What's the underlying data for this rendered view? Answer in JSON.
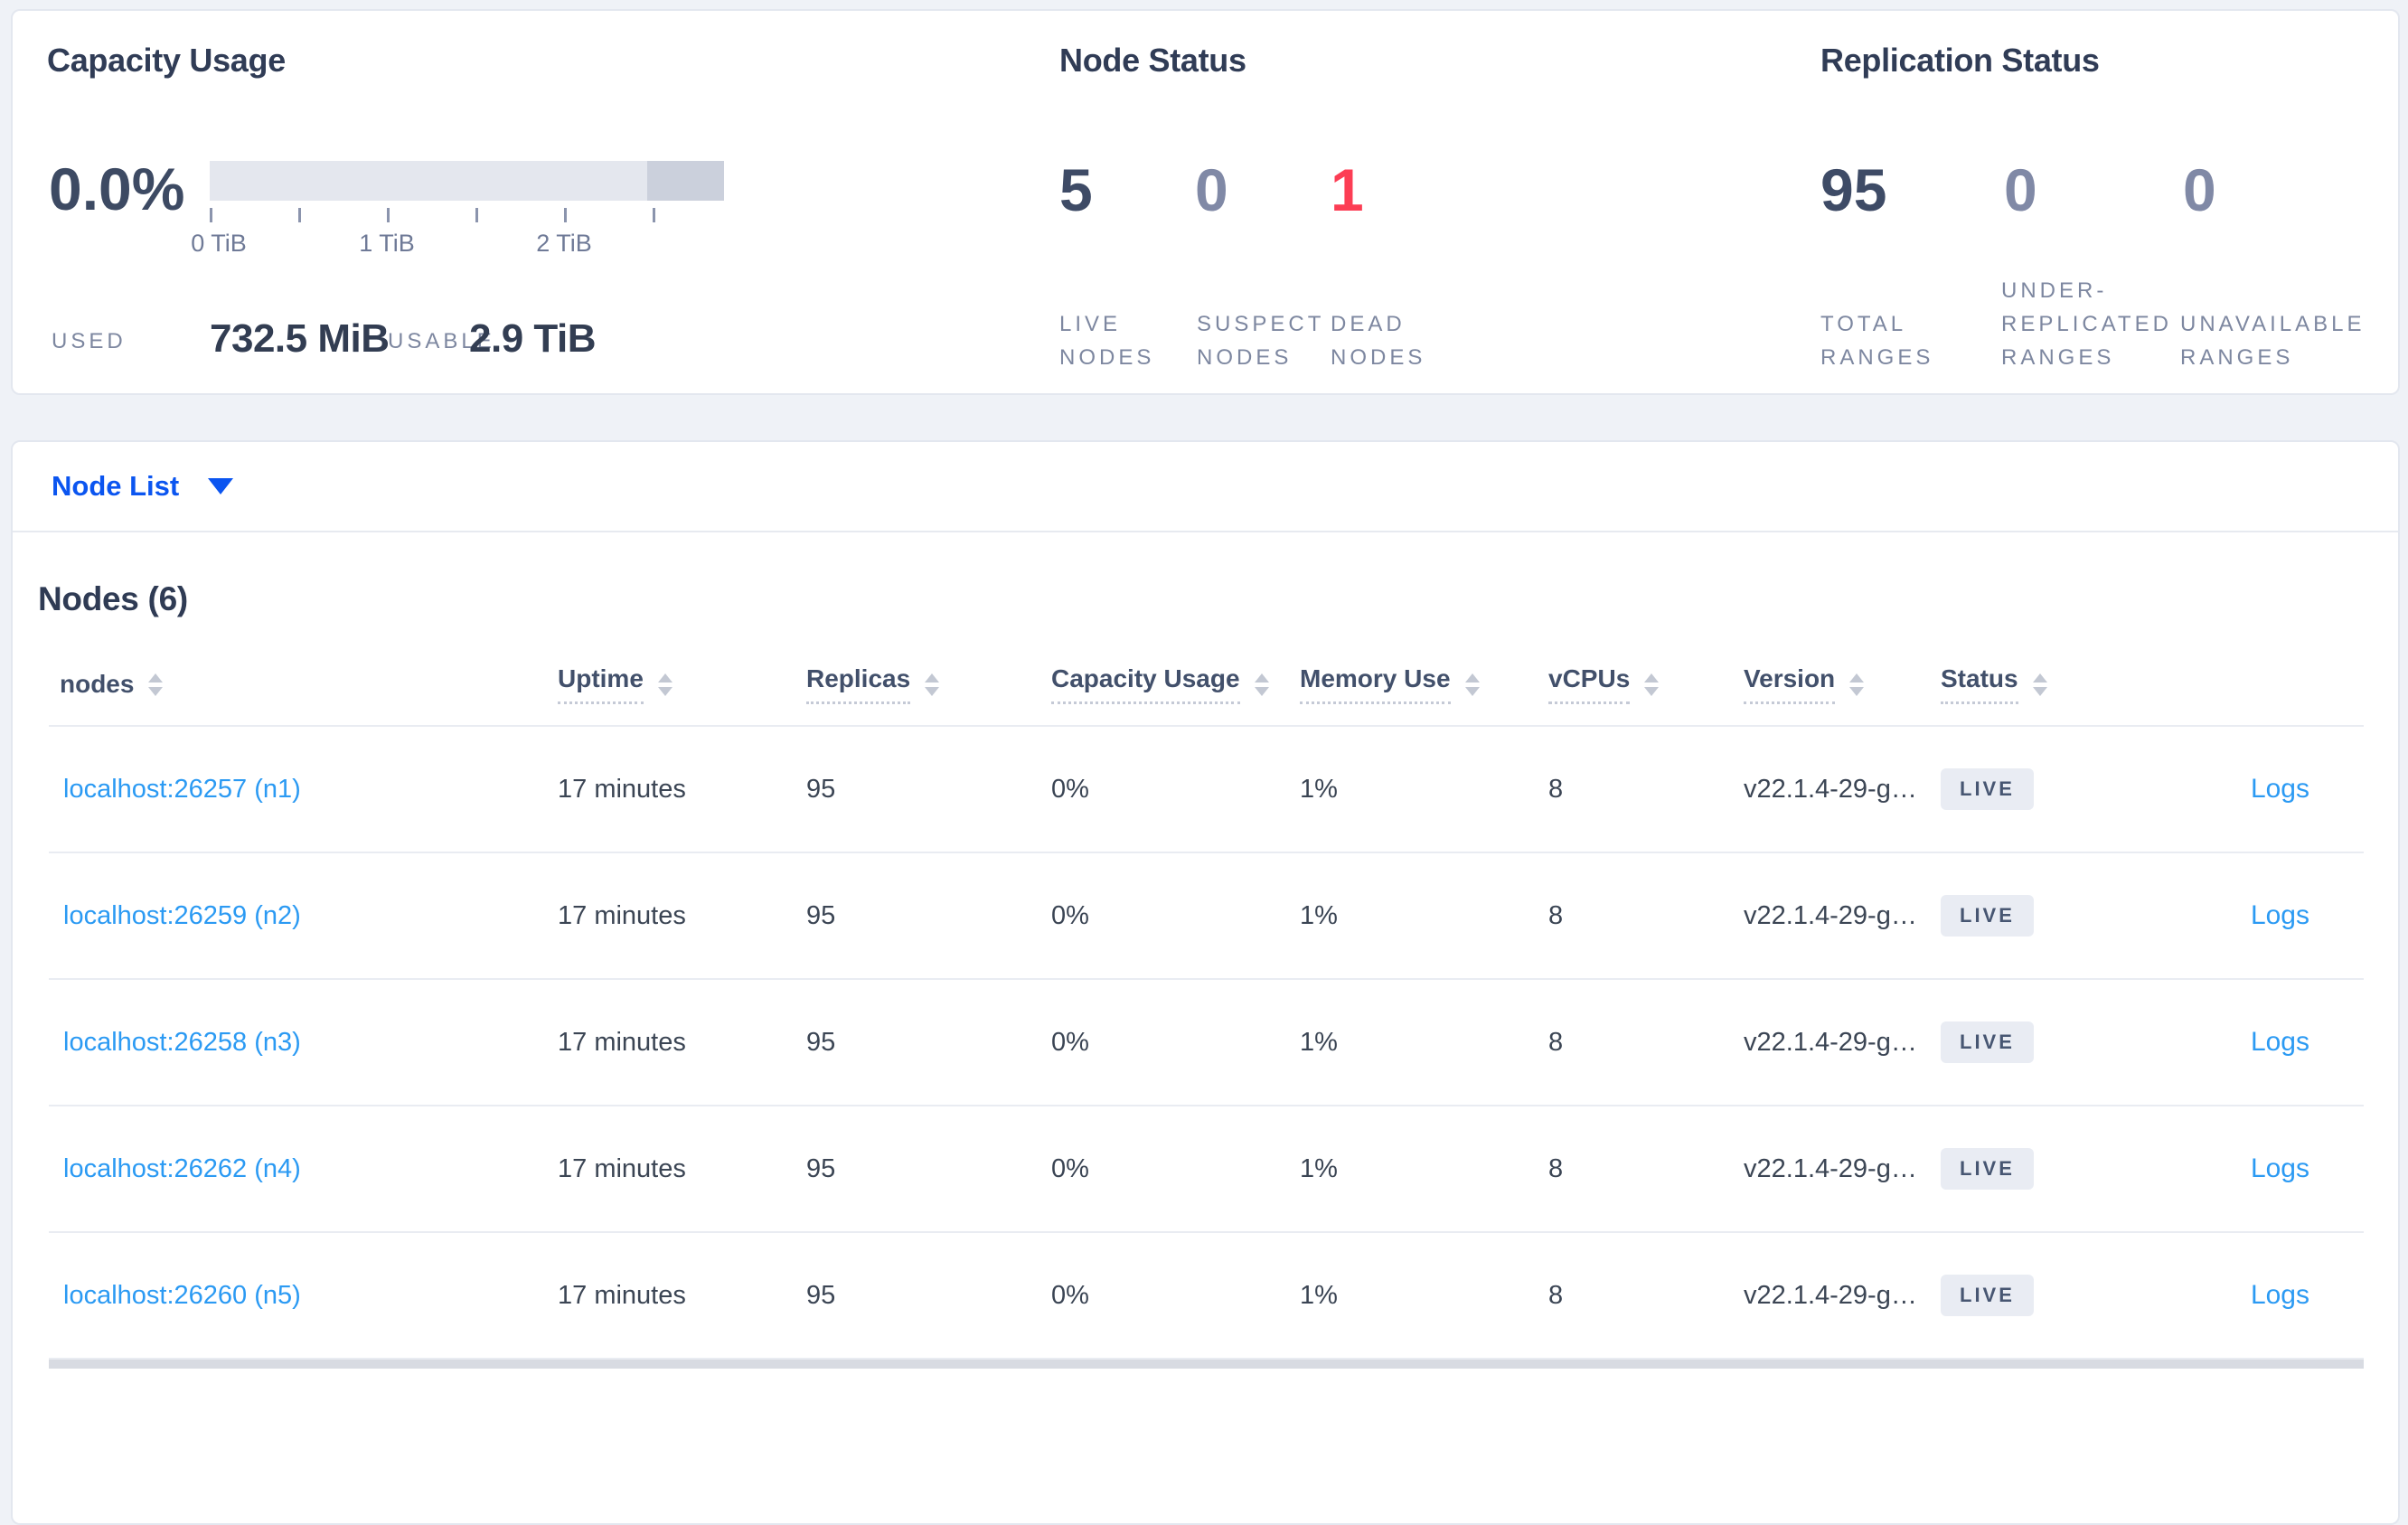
{
  "summary": {
    "capacity": {
      "title": "Capacity Usage",
      "percent": "0.0%",
      "used_label": "USED",
      "used_value": "732.5 MiB",
      "usable_label": "USABLE",
      "usable_value": "2.9 TiB",
      "axis_tick_labels": [
        "0 TiB",
        "1 TiB",
        "2 TiB"
      ]
    },
    "node_status": {
      "title": "Node Status",
      "stats": [
        {
          "value": "5",
          "label_lines": [
            "LIVE",
            "NODES"
          ]
        },
        {
          "value": "0",
          "label_lines": [
            "SUSPECT",
            "NODES"
          ]
        },
        {
          "value": "1",
          "label_lines": [
            "DEAD",
            "NODES"
          ]
        }
      ]
    },
    "replication": {
      "title": "Replication Status",
      "stats": [
        {
          "value": "95",
          "label_lines": [
            "TOTAL",
            "RANGES"
          ]
        },
        {
          "value": "0",
          "label_lines": [
            "UNDER-",
            "REPLICATED",
            "RANGES"
          ]
        },
        {
          "value": "0",
          "label_lines": [
            "UNAVAILABLE",
            "RANGES"
          ]
        }
      ]
    }
  },
  "node_list": {
    "selector_label": "Node List",
    "heading": "Nodes (6)"
  },
  "table": {
    "columns": [
      "nodes",
      "Uptime",
      "Replicas",
      "Capacity Usage",
      "Memory Use",
      "vCPUs",
      "Version",
      "Status"
    ],
    "rows": [
      {
        "node": "localhost:26257 (n1)",
        "uptime": "17 minutes",
        "replicas": "95",
        "capacity": "0%",
        "memory": "1%",
        "vcpus": "8",
        "version": "v22.1.4-29-g…",
        "status": "LIVE",
        "logs": "Logs"
      },
      {
        "node": "localhost:26259 (n2)",
        "uptime": "17 minutes",
        "replicas": "95",
        "capacity": "0%",
        "memory": "1%",
        "vcpus": "8",
        "version": "v22.1.4-29-g…",
        "status": "LIVE",
        "logs": "Logs"
      },
      {
        "node": "localhost:26258 (n3)",
        "uptime": "17 minutes",
        "replicas": "95",
        "capacity": "0%",
        "memory": "1%",
        "vcpus": "8",
        "version": "v22.1.4-29-g…",
        "status": "LIVE",
        "logs": "Logs"
      },
      {
        "node": "localhost:26262 (n4)",
        "uptime": "17 minutes",
        "replicas": "95",
        "capacity": "0%",
        "memory": "1%",
        "vcpus": "8",
        "version": "v22.1.4-29-g…",
        "status": "LIVE",
        "logs": "Logs"
      },
      {
        "node": "localhost:26260 (n5)",
        "uptime": "17 minutes",
        "replicas": "95",
        "capacity": "0%",
        "memory": "1%",
        "vcpus": "8",
        "version": "v22.1.4-29-g…",
        "status": "LIVE",
        "logs": "Logs"
      }
    ]
  },
  "colors": {
    "accent_blue": "#0b55f0",
    "link_blue": "#2b9af3",
    "dead_red": "#fc3d54",
    "muted_slate": "#8089a6",
    "dark_slate": "#3e4b66",
    "bar_light": "#e4e7ee",
    "bar_dark": "#cbd0dc",
    "badge_bg": "#e9ecf3"
  }
}
